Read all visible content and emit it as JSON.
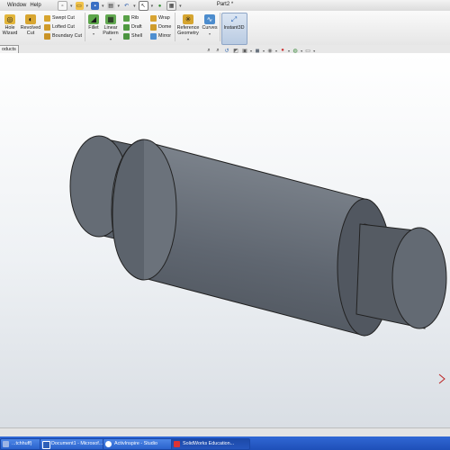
{
  "menu": {
    "items": [
      "Window",
      "Help"
    ]
  },
  "document_title": "Part2 *",
  "commands": {
    "hole_wizard": "Hole\nWizard",
    "revolved_cut": "Revolved\nCut",
    "swept_cut": "Swept Cut",
    "lofted_cut": "Lofted Cut",
    "boundary_cut": "Boundary Cut",
    "fillet": "Fillet",
    "linear_pattern": "Linear\nPattern",
    "rib": "Rib",
    "draft": "Draft",
    "shell": "Shell",
    "wrap": "Wrap",
    "dome": "Dome",
    "mirror": "Mirror",
    "reference_geometry": "Reference\nGeometry",
    "curves": "Curves",
    "instant3d": "Instant3D"
  },
  "tabs": {
    "products": "oducts"
  },
  "taskbar": {
    "items": [
      "...tchhuff)",
      "Document1 - Microsof...",
      "ActivInspire - Studio",
      "SolidWorks Education..."
    ]
  },
  "colors": {
    "part_body": "#5f6670",
    "part_dark": "#3a3f46",
    "ribbon_accent": "#f2b233",
    "taskbar": "#2556be"
  }
}
